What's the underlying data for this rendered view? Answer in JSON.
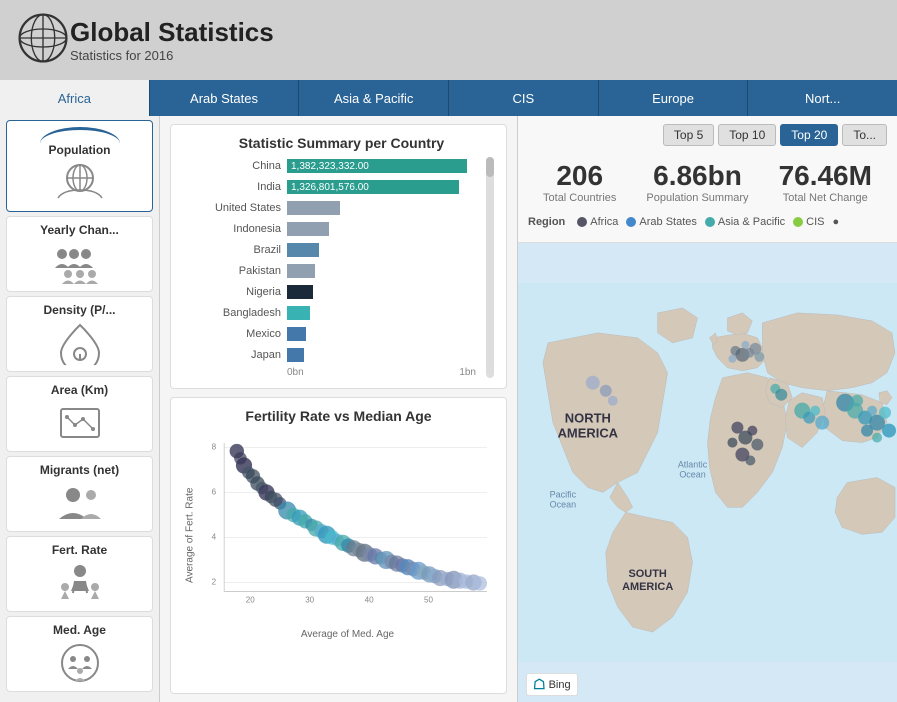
{
  "header": {
    "title": "Global Statistics",
    "subtitle": "Statistics for 2016"
  },
  "nav": {
    "items": [
      "Africa",
      "Arab States",
      "Asia & Pacific",
      "CIS",
      "Europe",
      "Nort..."
    ],
    "active": "Africa"
  },
  "sidebar": {
    "items": [
      {
        "id": "population",
        "label": "Population",
        "active": true
      },
      {
        "id": "yearly-change",
        "label": "Yearly Chan...",
        "active": false
      },
      {
        "id": "density",
        "label": "Density (P/...",
        "active": false
      },
      {
        "id": "area",
        "label": "Area (Km)",
        "active": false
      },
      {
        "id": "migrants",
        "label": "Migrants (net)",
        "active": false
      },
      {
        "id": "fert-rate",
        "label": "Fert. Rate",
        "active": false
      },
      {
        "id": "med-age",
        "label": "Med. Age",
        "active": false
      }
    ]
  },
  "bar_chart": {
    "title": "Statistic Summary per Country",
    "bars": [
      {
        "label": "China",
        "value": "1,382,323,332.00",
        "pct": 95,
        "color": "teal"
      },
      {
        "label": "India",
        "value": "1,326,801,576.00",
        "pct": 91,
        "color": "teal"
      },
      {
        "label": "United States",
        "value": "",
        "pct": 28,
        "color": "gray"
      },
      {
        "label": "Indonesia",
        "value": "",
        "pct": 22,
        "color": "gray"
      },
      {
        "label": "Brazil",
        "value": "",
        "pct": 17,
        "color": "gray"
      },
      {
        "label": "Pakistan",
        "value": "",
        "pct": 15,
        "color": "gray"
      },
      {
        "label": "Nigeria",
        "value": "",
        "pct": 14,
        "color": "dark"
      },
      {
        "label": "Bangladesh",
        "value": "",
        "pct": 12,
        "color": "teal-light"
      },
      {
        "label": "Mexico",
        "value": "",
        "pct": 10,
        "color": "gray-blue"
      },
      {
        "label": "Japan",
        "value": "",
        "pct": 9,
        "color": "gray-blue"
      }
    ],
    "x_axis": [
      "0bn",
      "1bn"
    ]
  },
  "scatter_chart": {
    "title": "Fertility Rate vs Median Age",
    "y_label": "Average of Fert. Rate",
    "x_label": "Average of Med. Age",
    "y_axis": [
      "8",
      "6",
      "4",
      "2"
    ],
    "x_axis": [
      "20",
      "30",
      "40",
      "50"
    ]
  },
  "right_panel": {
    "top_buttons": [
      "Top 5",
      "Top 10",
      "Top 20",
      "To..."
    ],
    "active_button": "Top 20",
    "stats": [
      {
        "value": "206",
        "label": "Total Countries"
      },
      {
        "value": "6.86bn",
        "label": "Population Summary"
      },
      {
        "value": "76.46M",
        "label": "Total Net Change"
      }
    ],
    "legend": {
      "label": "Region",
      "items": [
        {
          "name": "Africa",
          "color": "#555566"
        },
        {
          "name": "Arab States",
          "color": "#4488cc"
        },
        {
          "name": "Asia & Pacific",
          "color": "#44aaaa"
        },
        {
          "name": "CIS",
          "color": "#88cc44"
        }
      ]
    },
    "map": {
      "bing_label": "Bing",
      "regions": {
        "north_america": "NORTH AMERICA",
        "south_america": "SOUTH AMERICA",
        "pacific_ocean": "Pacific\nOcean",
        "atlantic_ocean": "Atlantic\nOcean"
      }
    }
  }
}
